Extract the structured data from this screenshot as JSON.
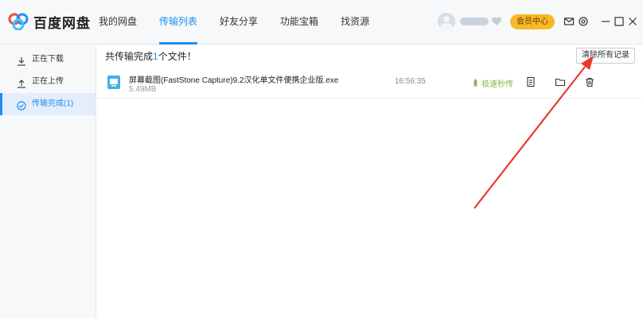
{
  "app": {
    "name": "百度网盘"
  },
  "nav": {
    "items": [
      {
        "label": "我的网盘",
        "active": false
      },
      {
        "label": "传输列表",
        "active": true
      },
      {
        "label": "好友分享",
        "active": false
      },
      {
        "label": "功能宝箱",
        "active": false
      },
      {
        "label": "找资源",
        "active": false
      }
    ]
  },
  "header": {
    "vip_label": "会员中心",
    "icons": [
      "mail-icon",
      "settings-icon",
      "minimize-icon",
      "maximize-icon",
      "close-icon"
    ]
  },
  "sidebar": {
    "items": [
      {
        "label": "正在下载",
        "icon": "download-icon",
        "active": false
      },
      {
        "label": "正在上传",
        "icon": "upload-icon",
        "active": false
      },
      {
        "label": "传输完成(1)",
        "icon": "check-circle-icon",
        "active": true
      }
    ]
  },
  "main": {
    "summary_prefix": "共传输完成",
    "summary_count": "1",
    "summary_suffix": "个文件！",
    "clear_label": "清除所有记录",
    "files": [
      {
        "name": "屏幕截图(FastStone Capture)9.2汉化单文件便携企业版.exe",
        "size": "5.49MB",
        "time": "16:56:35",
        "status": "极速秒传",
        "status_icon": "rocket-icon",
        "actions": [
          "document-icon",
          "folder-icon",
          "trash-icon"
        ]
      }
    ]
  },
  "colors": {
    "accent": "#1f8ef1",
    "vip": "#f7b928",
    "annotation_arrow": "#e83a30",
    "fast_status": "#8cb34d"
  }
}
